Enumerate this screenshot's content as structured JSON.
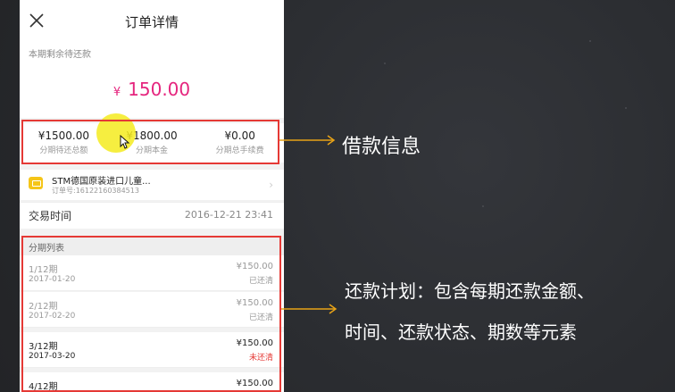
{
  "nav": {
    "title": "订单详情",
    "close_icon": "close-icon"
  },
  "remaining": {
    "label": "本期剩余待还款",
    "currency": "¥",
    "amount": "150.00"
  },
  "loan_info": [
    {
      "value": "¥1500.00",
      "label": "分期待还总额"
    },
    {
      "value": "¥1800.00",
      "label": "分期本金"
    },
    {
      "value": "¥0.00",
      "label": "分期总手续费"
    }
  ],
  "product": {
    "name": "STM德国原装进口儿童...",
    "order_no": "订单号:16122160384513"
  },
  "trade": {
    "label": "交易时间",
    "value": "2016-12-21 23:41"
  },
  "plan": {
    "header": "分期列表",
    "rows": [
      {
        "period": "1/12期",
        "date": "2017-01-20",
        "amount": "¥150.00",
        "status": "已还清"
      },
      {
        "period": "2/12期",
        "date": "2017-02-20",
        "amount": "¥150.00",
        "status": "已还清"
      },
      {
        "period": "3/12期",
        "date": "2017-03-20",
        "amount": "¥150.00",
        "status": "未还清"
      },
      {
        "period": "4/12期",
        "date": "",
        "amount": "¥150.00",
        "status": ""
      }
    ]
  },
  "annotations": {
    "loan": "借款信息",
    "plan_line1": "还款计划：包含每期还款金额、",
    "plan_line2": "时间、还款状态、期数等元素"
  },
  "colors": {
    "accent": "#e5257e",
    "annotation_box": "#e53935",
    "arrow": "#e8a317",
    "unpaid": "#e53935"
  }
}
